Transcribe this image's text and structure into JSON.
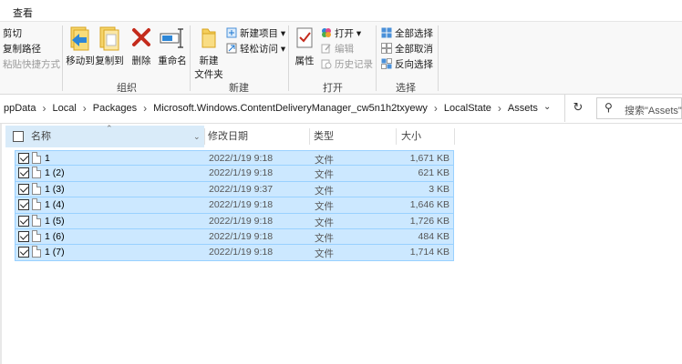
{
  "menu": {
    "view": "查看"
  },
  "ribbon": {
    "clipboard": {
      "cut": "剪切",
      "copy_path": "复制路径",
      "paste_shortcut": "粘贴快捷方式"
    },
    "organize": {
      "label": "组织",
      "move_to": "移动到",
      "copy_to": "复制到",
      "delete": "删除",
      "rename": "重命名"
    },
    "new": {
      "label": "新建",
      "new_folder": "新建\n文件夹",
      "new_folder_line1": "新建",
      "new_folder_line2": "文件夹",
      "new_item": "新建项目",
      "easy_access": "轻松访问"
    },
    "open": {
      "label": "打开",
      "properties": "属性",
      "open": "打开",
      "edit": "编辑",
      "history": "历史记录"
    },
    "select": {
      "label": "选择",
      "select_all": "全部选择",
      "select_none": "全部取消",
      "invert": "反向选择"
    }
  },
  "address": {
    "crumbs": [
      "ppData",
      "Local",
      "Packages",
      "Microsoft.Windows.ContentDeliveryManager_cw5n1h2txyewy",
      "LocalState",
      "Assets"
    ],
    "search_placeholder": "搜索\"Assets\""
  },
  "columns": {
    "name": "名称",
    "modified": "修改日期",
    "type": "类型",
    "size": "大小"
  },
  "files": [
    {
      "name": "1",
      "modified": "2022/1/19 9:18",
      "type": "文件",
      "size": "1,671 KB"
    },
    {
      "name": "1 (2)",
      "modified": "2022/1/19 9:18",
      "type": "文件",
      "size": "621 KB"
    },
    {
      "name": "1 (3)",
      "modified": "2022/1/19 9:37",
      "type": "文件",
      "size": "3 KB"
    },
    {
      "name": "1 (4)",
      "modified": "2022/1/19 9:18",
      "type": "文件",
      "size": "1,646 KB"
    },
    {
      "name": "1 (5)",
      "modified": "2022/1/19 9:18",
      "type": "文件",
      "size": "1,726 KB"
    },
    {
      "name": "1 (6)",
      "modified": "2022/1/19 9:18",
      "type": "文件",
      "size": "484 KB"
    },
    {
      "name": "1 (7)",
      "modified": "2022/1/19 9:18",
      "type": "文件",
      "size": "1,714 KB"
    }
  ],
  "colors": {
    "selection_bg": "#cce8ff",
    "selection_border": "#99d1ff",
    "delete_red": "#c42b1c",
    "folder_yellow": "#f0c040",
    "accent_blue": "#1e78d2"
  }
}
